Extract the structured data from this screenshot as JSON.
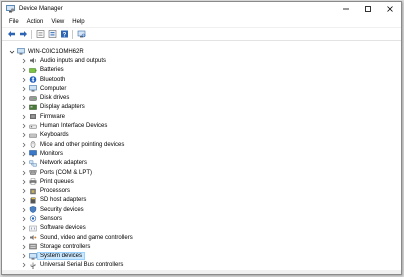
{
  "window": {
    "title": "Device Manager"
  },
  "menu": [
    "File",
    "Action",
    "View",
    "Help"
  ],
  "toolbar": [
    "back-icon",
    "forward-icon",
    "properties-icon",
    "show-hidden-icon",
    "help-icon",
    "scan-icon"
  ],
  "tree": {
    "root": "WIN-C0IC1OMH62R",
    "selected_index": 25,
    "items": [
      {
        "label": "Audio inputs and outputs",
        "icon": "speaker-icon"
      },
      {
        "label": "Batteries",
        "icon": "battery-icon"
      },
      {
        "label": "Bluetooth",
        "icon": "bluetooth-icon"
      },
      {
        "label": "Computer",
        "icon": "computer-icon"
      },
      {
        "label": "Disk drives",
        "icon": "disk-icon"
      },
      {
        "label": "Display adapters",
        "icon": "display-icon"
      },
      {
        "label": "Firmware",
        "icon": "firmware-icon"
      },
      {
        "label": "Human Interface Devices",
        "icon": "hid-icon"
      },
      {
        "label": "Keyboards",
        "icon": "keyboard-icon"
      },
      {
        "label": "Mice and other pointing devices",
        "icon": "mouse-icon"
      },
      {
        "label": "Monitors",
        "icon": "monitor-icon"
      },
      {
        "label": "Network adapters",
        "icon": "network-icon"
      },
      {
        "label": "Ports (COM & LPT)",
        "icon": "port-icon"
      },
      {
        "label": "Print queues",
        "icon": "printer-icon"
      },
      {
        "label": "Processors",
        "icon": "processor-icon"
      },
      {
        "label": "SD host adapters",
        "icon": "sd-icon"
      },
      {
        "label": "Security devices",
        "icon": "security-icon"
      },
      {
        "label": "Sensors",
        "icon": "sensor-icon"
      },
      {
        "label": "Software devices",
        "icon": "software-icon"
      },
      {
        "label": "Sound, video and game controllers",
        "icon": "sound-icon"
      },
      {
        "label": "Storage controllers",
        "icon": "storage-icon"
      },
      {
        "label": "System devices",
        "icon": "system-icon"
      },
      {
        "label": "Universal Serial Bus controllers",
        "icon": "usb-icon"
      }
    ]
  },
  "colors": {
    "selection": "#cce8ff",
    "selection_border": "#99d1ff",
    "nav_blue": "#2d64b3"
  }
}
